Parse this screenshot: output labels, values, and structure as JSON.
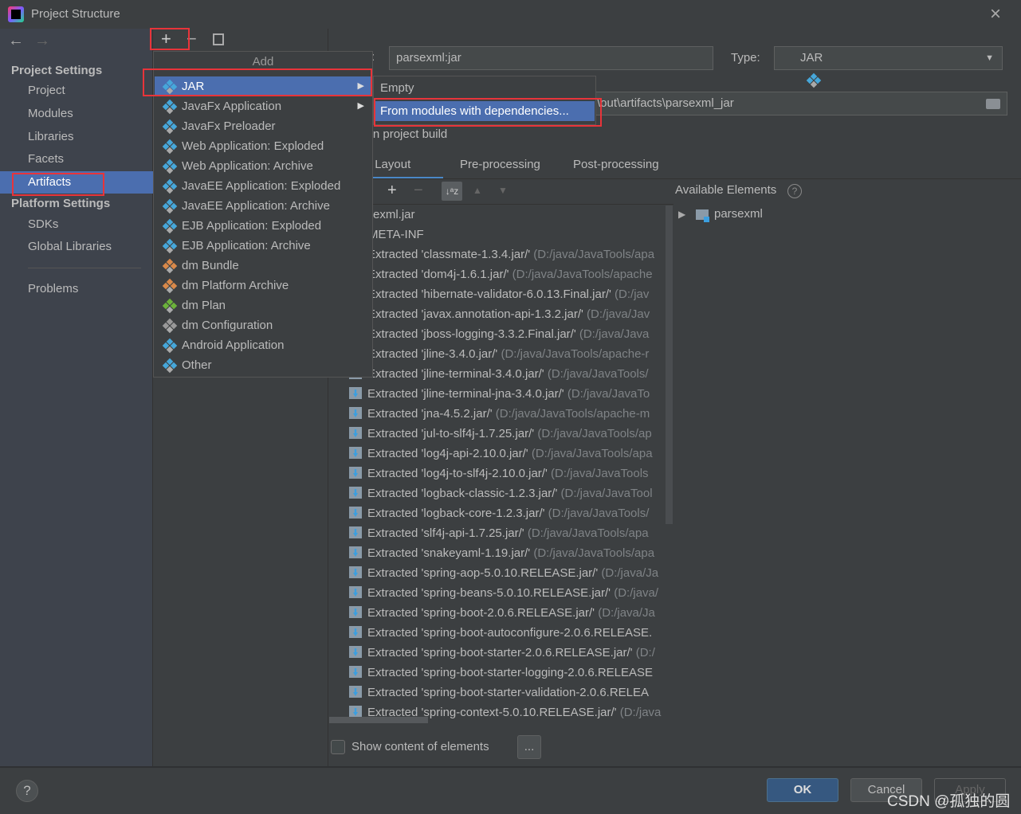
{
  "window": {
    "title": "Project Structure",
    "close": "×"
  },
  "nav": {
    "back": "←",
    "forward": "→"
  },
  "toolbar": {
    "add": "+",
    "remove": "−",
    "copy": "copy"
  },
  "sidebar": {
    "project_settings": "Project Settings",
    "items": [
      "Project",
      "Modules",
      "Libraries",
      "Facets",
      "Artifacts"
    ],
    "platform_settings": "Platform Settings",
    "platform_items": [
      "SDKs",
      "Global Libraries"
    ],
    "problems": "Problems",
    "selected": "Artifacts"
  },
  "add_menu": {
    "title": "Add",
    "items": [
      {
        "label": "JAR",
        "icon": "jar-icon",
        "submenu": true,
        "selected": true
      },
      {
        "label": "JavaFx Application",
        "icon": "javafx-icon",
        "submenu": true
      },
      {
        "label": "JavaFx Preloader",
        "icon": "javafx-icon"
      },
      {
        "label": "Web Application: Exploded",
        "icon": "web-icon"
      },
      {
        "label": "Web Application: Archive",
        "icon": "web-icon"
      },
      {
        "label": "JavaEE Application: Exploded",
        "icon": "javaee-icon"
      },
      {
        "label": "JavaEE Application: Archive",
        "icon": "javaee-icon"
      },
      {
        "label": "EJB Application: Exploded",
        "icon": "ejb-icon"
      },
      {
        "label": "EJB Application: Archive",
        "icon": "ejb-icon"
      },
      {
        "label": "dm Bundle",
        "icon": "bundle-icon"
      },
      {
        "label": "dm Platform Archive",
        "icon": "bundle-icon"
      },
      {
        "label": "dm Plan",
        "icon": "globe-icon"
      },
      {
        "label": "dm Configuration",
        "icon": "config-icon"
      },
      {
        "label": "Android Application",
        "icon": "android-icon"
      },
      {
        "label": "Other",
        "icon": "other-icon"
      }
    ]
  },
  "jar_submenu": {
    "items": [
      "Empty",
      "From modules with dependencies..."
    ],
    "selected": "From modules with dependencies..."
  },
  "artifact": {
    "name_label": ":",
    "name": "parsexml:jar",
    "type_label": "Type:",
    "type": "JAR",
    "output_dir": "\\out\\artifacts\\parsexml_jar",
    "include_build": "Include in project build",
    "tabs": [
      "Output Layout",
      "Pre-processing",
      "Post-processing"
    ],
    "active_tab": "Output Layout",
    "available_elements": "Available Elements",
    "available_tree": [
      "parsexml"
    ],
    "show_content": "Show content of elements",
    "more": "..."
  },
  "layout_rows": [
    {
      "name": "exml.jar",
      "path": ""
    },
    {
      "name": "META-INF",
      "path": ""
    },
    {
      "name": "Extracted 'classmate-1.3.4.jar/'",
      "path": " (D:/java/JavaTools/apa"
    },
    {
      "name": "Extracted 'dom4j-1.6.1.jar/'",
      "path": " (D:/java/JavaTools/apache"
    },
    {
      "name": "Extracted 'hibernate-validator-6.0.13.Final.jar/'",
      "path": " (D:/jav"
    },
    {
      "name": "Extracted 'javax.annotation-api-1.3.2.jar/'",
      "path": " (D:/java/Jav"
    },
    {
      "name": "Extracted 'jboss-logging-3.3.2.Final.jar/'",
      "path": " (D:/java/Java"
    },
    {
      "name": "Extracted 'jline-3.4.0.jar/'",
      "path": " (D:/java/JavaTools/apache-r"
    },
    {
      "name": "Extracted 'jline-terminal-3.4.0.jar/'",
      "path": " (D:/java/JavaTools/"
    },
    {
      "name": "Extracted 'jline-terminal-jna-3.4.0.jar/'",
      "path": " (D:/java/JavaTo"
    },
    {
      "name": "Extracted 'jna-4.5.2.jar/'",
      "path": " (D:/java/JavaTools/apache-m"
    },
    {
      "name": "Extracted 'jul-to-slf4j-1.7.25.jar/'",
      "path": " (D:/java/JavaTools/ap"
    },
    {
      "name": "Extracted 'log4j-api-2.10.0.jar/'",
      "path": " (D:/java/JavaTools/apa"
    },
    {
      "name": "Extracted 'log4j-to-slf4j-2.10.0.jar/'",
      "path": " (D:/java/JavaTools"
    },
    {
      "name": "Extracted 'logback-classic-1.2.3.jar/'",
      "path": " (D:/java/JavaTool"
    },
    {
      "name": "Extracted 'logback-core-1.2.3.jar/'",
      "path": " (D:/java/JavaTools/"
    },
    {
      "name": "Extracted 'slf4j-api-1.7.25.jar/'",
      "path": " (D:/java/JavaTools/apa"
    },
    {
      "name": "Extracted 'snakeyaml-1.19.jar/'",
      "path": " (D:/java/JavaTools/apa"
    },
    {
      "name": "Extracted 'spring-aop-5.0.10.RELEASE.jar/'",
      "path": " (D:/java/Ja"
    },
    {
      "name": "Extracted 'spring-beans-5.0.10.RELEASE.jar/'",
      "path": " (D:/java/"
    },
    {
      "name": "Extracted 'spring-boot-2.0.6.RELEASE.jar/'",
      "path": " (D:/java/Ja"
    },
    {
      "name": "Extracted 'spring-boot-autoconfigure-2.0.6.RELEASE.",
      "path": ""
    },
    {
      "name": "Extracted 'spring-boot-starter-2.0.6.RELEASE.jar/'",
      "path": " (D:/"
    },
    {
      "name": "Extracted 'spring-boot-starter-logging-2.0.6.RELEASE",
      "path": ""
    },
    {
      "name": "Extracted 'spring-boot-starter-validation-2.0.6.RELEA",
      "path": ""
    },
    {
      "name": "Extracted 'spring-context-5.0.10.RELEASE.jar/'",
      "path": " (D:/java"
    }
  ],
  "footer": {
    "help": "?",
    "ok": "OK",
    "cancel": "Cancel",
    "apply": "Apply"
  },
  "watermark": "CSDN @孤独的圆",
  "colors": {
    "selection": "#4b6eaf",
    "highlight_box": "#e8343a",
    "ok_button": "#365880"
  }
}
